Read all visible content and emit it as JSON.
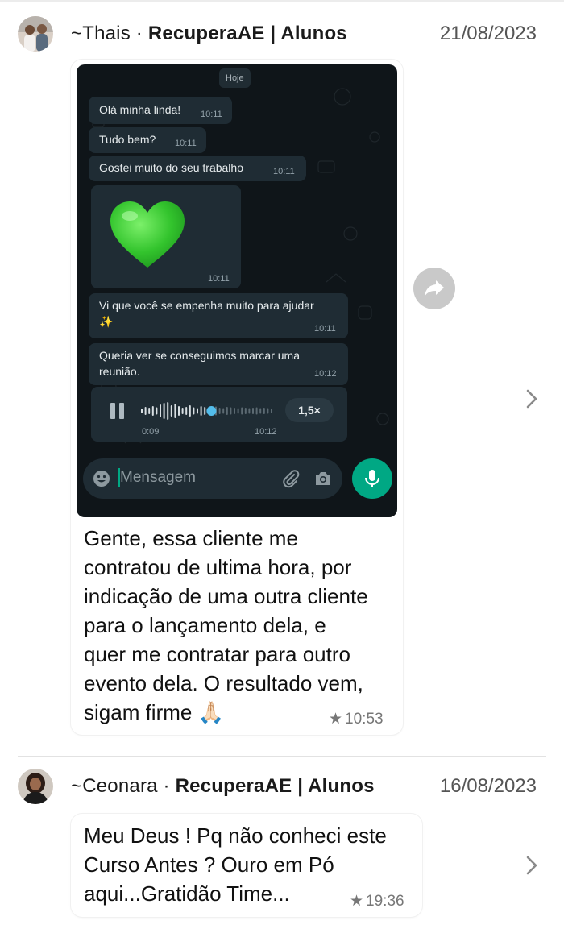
{
  "entries": [
    {
      "sender": "~Thais",
      "separator": " · ",
      "group": "RecuperaAE | Alunos",
      "date": "21/08/2023",
      "whatsapp": {
        "day_label": "Hoje",
        "messages": [
          {
            "text": "Olá minha linda!",
            "time": "10:11"
          },
          {
            "text": "Tudo bem?",
            "time": "10:11"
          },
          {
            "text": "Gostei muito do seu trabalho",
            "time": "10:11"
          },
          {
            "text": "💚",
            "time": "10:11"
          },
          {
            "text": "Vi que você se empenha muito para ajudar\n✨",
            "time": "10:11"
          },
          {
            "text": "Queria ver se conseguimos marcar uma\nreunião.",
            "time": "10:12"
          }
        ],
        "audio": {
          "elapsed": "0:09",
          "time": "10:12",
          "speed": "1,5×",
          "progress": 0.52
        },
        "input_placeholder": "Mensagem"
      },
      "caption": "Gente, essa cliente me\ncontratou de ultima hora, por\nindicação de uma outra cliente\npara o lançamento dela, e\nquer me contratar para outro\nevento dela. O resultado vem,\nsigam firme 🙏🏻",
      "star": "★",
      "time": "10:53"
    },
    {
      "sender": "~Ceonara",
      "separator": " · ",
      "group": "RecuperaAE | Alunos",
      "date": "16/08/2023",
      "text": "Meu Deus ! Pq não conheci este\nCurso Antes ? Ouro em Pó\naqui...Gratidão Time...",
      "star": "★",
      "time": "19:36"
    }
  ],
  "colors": {
    "whatsapp_green": "#00a884",
    "whatsapp_bg": "#0f1519",
    "whatsapp_bubble": "#1f2c34",
    "heart": "#3ed13a"
  }
}
